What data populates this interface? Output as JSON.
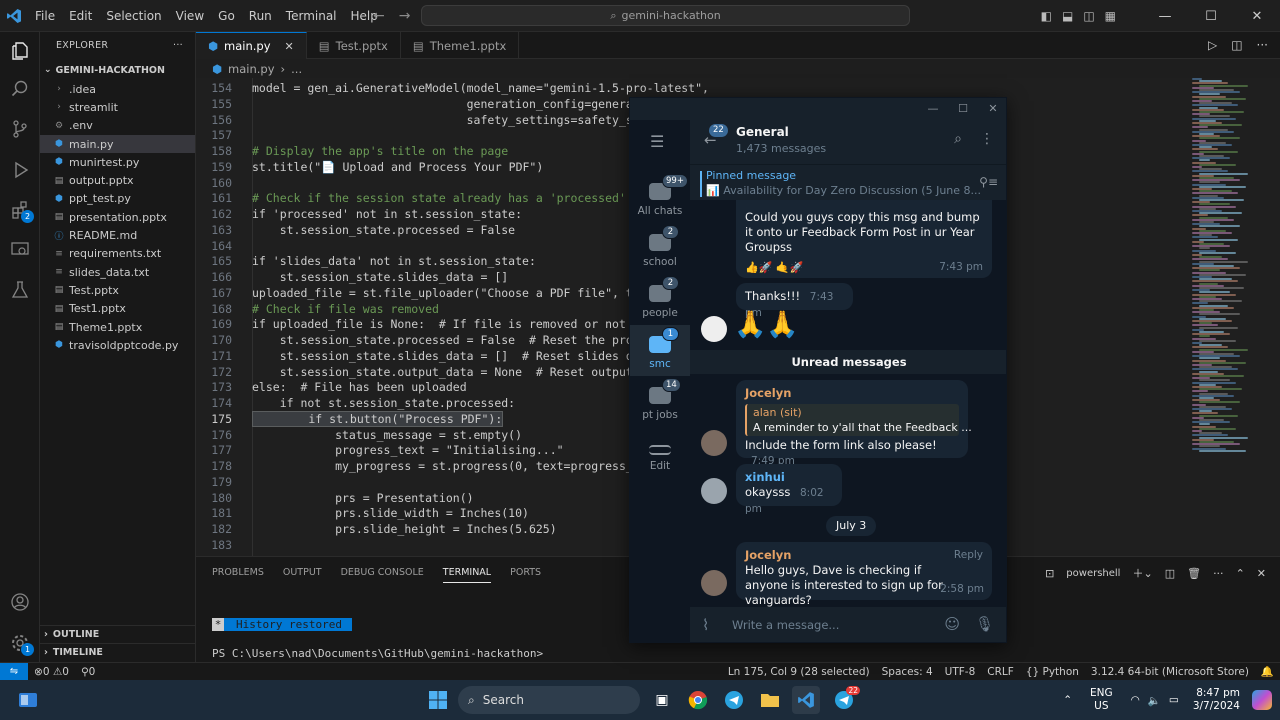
{
  "titlebar": {
    "menu": [
      "File",
      "Edit",
      "Selection",
      "View",
      "Go",
      "Run",
      "Terminal",
      "Help"
    ],
    "search": "gemini-hackathon"
  },
  "explorer": {
    "header": "EXPLORER",
    "project": "GEMINI-HACKATHON",
    "items": [
      {
        "label": ".idea",
        "kind": "folder"
      },
      {
        "label": "streamlit",
        "kind": "folder"
      },
      {
        "label": ".env",
        "kind": "gear"
      },
      {
        "label": "main.py",
        "kind": "py"
      },
      {
        "label": "munirtest.py",
        "kind": "py"
      },
      {
        "label": "output.pptx",
        "kind": "pptx"
      },
      {
        "label": "ppt_test.py",
        "kind": "py"
      },
      {
        "label": "presentation.pptx",
        "kind": "pptx"
      },
      {
        "label": "README.md",
        "kind": "md"
      },
      {
        "label": "requirements.txt",
        "kind": "txt"
      },
      {
        "label": "slides_data.txt",
        "kind": "txt"
      },
      {
        "label": "Test.pptx",
        "kind": "pptx"
      },
      {
        "label": "Test1.pptx",
        "kind": "pptx"
      },
      {
        "label": "Theme1.pptx",
        "kind": "pptx"
      },
      {
        "label": "travisoldpptcode.py",
        "kind": "py"
      }
    ],
    "outline": "OUTLINE",
    "timeline": "TIMELINE"
  },
  "tabs": [
    {
      "label": "main.py",
      "active": true
    },
    {
      "label": "Test.pptx",
      "active": false
    },
    {
      "label": "Theme1.pptx",
      "active": false
    }
  ],
  "breadcrumb": {
    "file": "main.py",
    "rest": "..."
  },
  "editor": {
    "lines": [
      {
        "n": "154",
        "t": "model = gen_ai.GenerativeModel(model_name=\"gemini-1.5-pro-latest\","
      },
      {
        "n": "155",
        "t": "                               generation_config=generation"
      },
      {
        "n": "156",
        "t": "                               safety_settings=safety_setti"
      },
      {
        "n": "157",
        "t": ""
      },
      {
        "n": "158",
        "t": "# Display the app's title on the page"
      },
      {
        "n": "159",
        "t": "st.title(\"📄 Upload and Process Your PDF\")"
      },
      {
        "n": "160",
        "t": ""
      },
      {
        "n": "161",
        "t": "# Check if the session state already has a 'processed' flag"
      },
      {
        "n": "162",
        "t": "if 'processed' not in st.session_state:"
      },
      {
        "n": "163",
        "t": "    st.session_state.processed = False"
      },
      {
        "n": "164",
        "t": ""
      },
      {
        "n": "165",
        "t": "if 'slides_data' not in st.session_state:"
      },
      {
        "n": "166",
        "t": "    st.session_state.slides_data = []"
      },
      {
        "n": "167",
        "t": "uploaded_file = st.file_uploader(\"Choose a PDF file\", type="
      },
      {
        "n": "168",
        "t": "# Check if file was removed"
      },
      {
        "n": "169",
        "t": "if uploaded_file is None:  # If file is removed or not uplo"
      },
      {
        "n": "170",
        "t": "    st.session_state.processed = False  # Reset the process"
      },
      {
        "n": "171",
        "t": "    st.session_state.slides_data = []  # Reset slides data"
      },
      {
        "n": "172",
        "t": "    st.session_state.output_data = None  # Reset output dat"
      },
      {
        "n": "173",
        "t": "else:  # File has been uploaded"
      },
      {
        "n": "174",
        "t": "    if not st.session_state.processed:"
      },
      {
        "n": "175",
        "t": "        if st.button(\"Process PDF\"):"
      },
      {
        "n": "176",
        "t": "            status_message = st.empty()"
      },
      {
        "n": "177",
        "t": "            progress_text = \"Initialising...\""
      },
      {
        "n": "178",
        "t": "            my_progress = st.progress(0, text=progress_text"
      },
      {
        "n": "179",
        "t": ""
      },
      {
        "n": "180",
        "t": "            prs = Presentation()"
      },
      {
        "n": "181",
        "t": "            prs.slide_width = Inches(10)"
      },
      {
        "n": "182",
        "t": "            prs.slide_height = Inches(5.625)"
      },
      {
        "n": "183",
        "t": ""
      }
    ]
  },
  "panel": {
    "tabs": [
      "PROBLEMS",
      "OUTPUT",
      "DEBUG CONSOLE",
      "TERMINAL",
      "PORTS"
    ],
    "active_tab": "TERMINAL",
    "shell": "powershell",
    "history_mark": "*",
    "history": "History restored",
    "prompt": "PS C:\\Users\\nad\\Documents\\GitHub\\gemini-hackathon>"
  },
  "statusbar": {
    "errors": "0",
    "warnings": "0",
    "ports": "0",
    "position": "Ln 175, Col 9 (28 selected)",
    "spaces": "Spaces: 4",
    "encoding": "UTF-8",
    "eol": "CRLF",
    "language": "Python",
    "interpreter": "3.12.4 64-bit (Microsoft Store)"
  },
  "taskbar": {
    "search": "Search",
    "lang": "ENG",
    "region": "US",
    "time": "8:47 pm",
    "date": "3/7/2024",
    "telegram_badge": "22"
  },
  "telegram": {
    "folders": [
      {
        "label": "All chats",
        "badge": "99+",
        "active": false
      },
      {
        "label": "school",
        "badge": "2",
        "active": false
      },
      {
        "label": "people",
        "badge": "2",
        "active": false
      },
      {
        "label": "smc",
        "badge": "1",
        "active": true
      },
      {
        "label": "pt jobs",
        "badge": "14",
        "active": false
      },
      {
        "label": "Edit",
        "badge": "",
        "active": false
      }
    ],
    "back_badge": "22",
    "chat_title": "General",
    "chat_sub": "1,473 messages",
    "pinned_label": "Pinned message",
    "pinned_text": "📊 Availability for Day Zero Discussion (5 June 8...",
    "msg1": {
      "text": "Could you guys copy this msg and bump it onto ur Feedback Form Post in ur Year Groupss",
      "reactions": "👍🚀  🤙🚀",
      "time": "7:43 pm"
    },
    "msg2": {
      "text": "Thanks!!!",
      "time": "7:43 pm"
    },
    "msg3": {
      "emoji": "🙏🙏"
    },
    "unread": "Unread messages",
    "msg4": {
      "sender": "Jocelyn",
      "reply_name": "alan (sit)",
      "reply_text": "A reminder to y'all that the Feedback ...",
      "text": "Include the form link also please!",
      "time": "7:49 pm"
    },
    "msg5": {
      "sender": "xinhui",
      "text": "okaysss",
      "time": "8:02 pm"
    },
    "date": "July 3",
    "msg6": {
      "sender": "Jocelyn",
      "reply": "Reply",
      "text": "Hello guys, Dave is checking if anyone is interested to sign up for vanguards?",
      "time": "2:58 pm"
    },
    "compose_placeholder": "Write a message..."
  }
}
